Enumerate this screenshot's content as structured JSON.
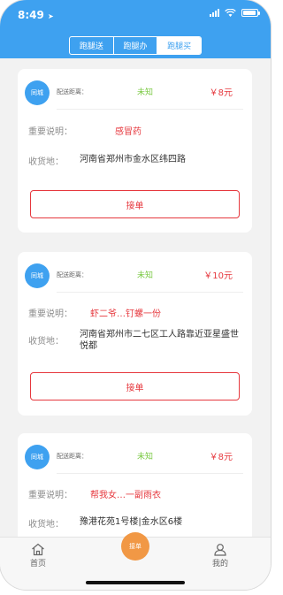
{
  "status_bar": {
    "time": "8:49",
    "location_glyph": "➤"
  },
  "tabs": [
    {
      "label": "跑腿送",
      "active": false
    },
    {
      "label": "跑腿办",
      "active": false
    },
    {
      "label": "跑腿买",
      "active": true
    }
  ],
  "orders": [
    {
      "badge": "同城",
      "distance_label": "配送距离：",
      "distance_value": "未知",
      "price": "￥8元",
      "note_label": "重要说明：",
      "note_value": "感冒药",
      "address_label": "收货地：",
      "address_value": "河南省郑州市金水区纬四路",
      "accept_label": "接单"
    },
    {
      "badge": "同城",
      "distance_label": "配送距离：",
      "distance_value": "未知",
      "price": "￥10元",
      "note_label": "重要说明：",
      "note_value": "虾二爷…钉螺一份",
      "address_label": "收货地：",
      "address_value": "河南省郑州市二七区工人路靠近亚星盛世悦都",
      "accept_label": "接单"
    },
    {
      "badge": "同城",
      "distance_label": "配送距离：",
      "distance_value": "未知",
      "price": "￥8元",
      "note_label": "重要说明：",
      "note_value": "帮我女…一副雨衣",
      "address_label": "收货地：",
      "address_value": "豫港花苑1号楼|金水区6楼"
    }
  ],
  "tabbar": {
    "home_label": "首页",
    "center_label": "接单",
    "me_label": "我的"
  },
  "colors": {
    "primary_blue": "#3ea1f0",
    "accent_red": "#e6383e",
    "distance_green": "#7ac943",
    "center_orange": "#f19845"
  }
}
